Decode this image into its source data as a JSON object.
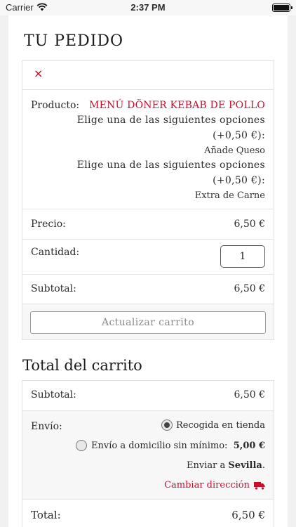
{
  "status_bar": {
    "carrier": "Carrier",
    "time": "2:37 PM"
  },
  "order": {
    "title": "TU PEDIDO",
    "remove_symbol": "×",
    "product_label": "Producto:",
    "product_name": "MENÚ DÖNER KEBAB DE POLLO",
    "options": [
      {
        "line1": "Elige una de las siguientes opciones",
        "line2": "(+0,50 €):",
        "value": "Añade Queso"
      },
      {
        "line1": "Elige una de las siguientes opciones",
        "line2": "(+0,50 €):",
        "value": "Extra de Carne"
      }
    ],
    "price_label": "Precio:",
    "price_value": "6,50 €",
    "quantity_label": "Cantidad:",
    "quantity_value": "1",
    "subtotal_label": "Subtotal:",
    "subtotal_value": "6,50 €",
    "update_button": "Actualizar carrito"
  },
  "totals": {
    "title": "Total del carrito",
    "subtotal_label": "Subtotal:",
    "subtotal_value": "6,50 €",
    "shipping_label": "Envío:",
    "shipping_options": [
      {
        "label": "Recogida en tienda",
        "price": "",
        "checked": true
      },
      {
        "label": "Envío a domicilio sin mínimo:",
        "price": "5,00 €",
        "checked": false
      }
    ],
    "ship_to_prefix": "Enviar a",
    "ship_to_city": "Sevilla",
    "ship_to_suffix": ".",
    "change_address": "Cambiar dirección",
    "total_label": "Total:",
    "total_value": "6,50 €"
  },
  "colors": {
    "accent": "#c8102e",
    "text": "#2b2b2b",
    "muted": "#8b8b8b"
  }
}
